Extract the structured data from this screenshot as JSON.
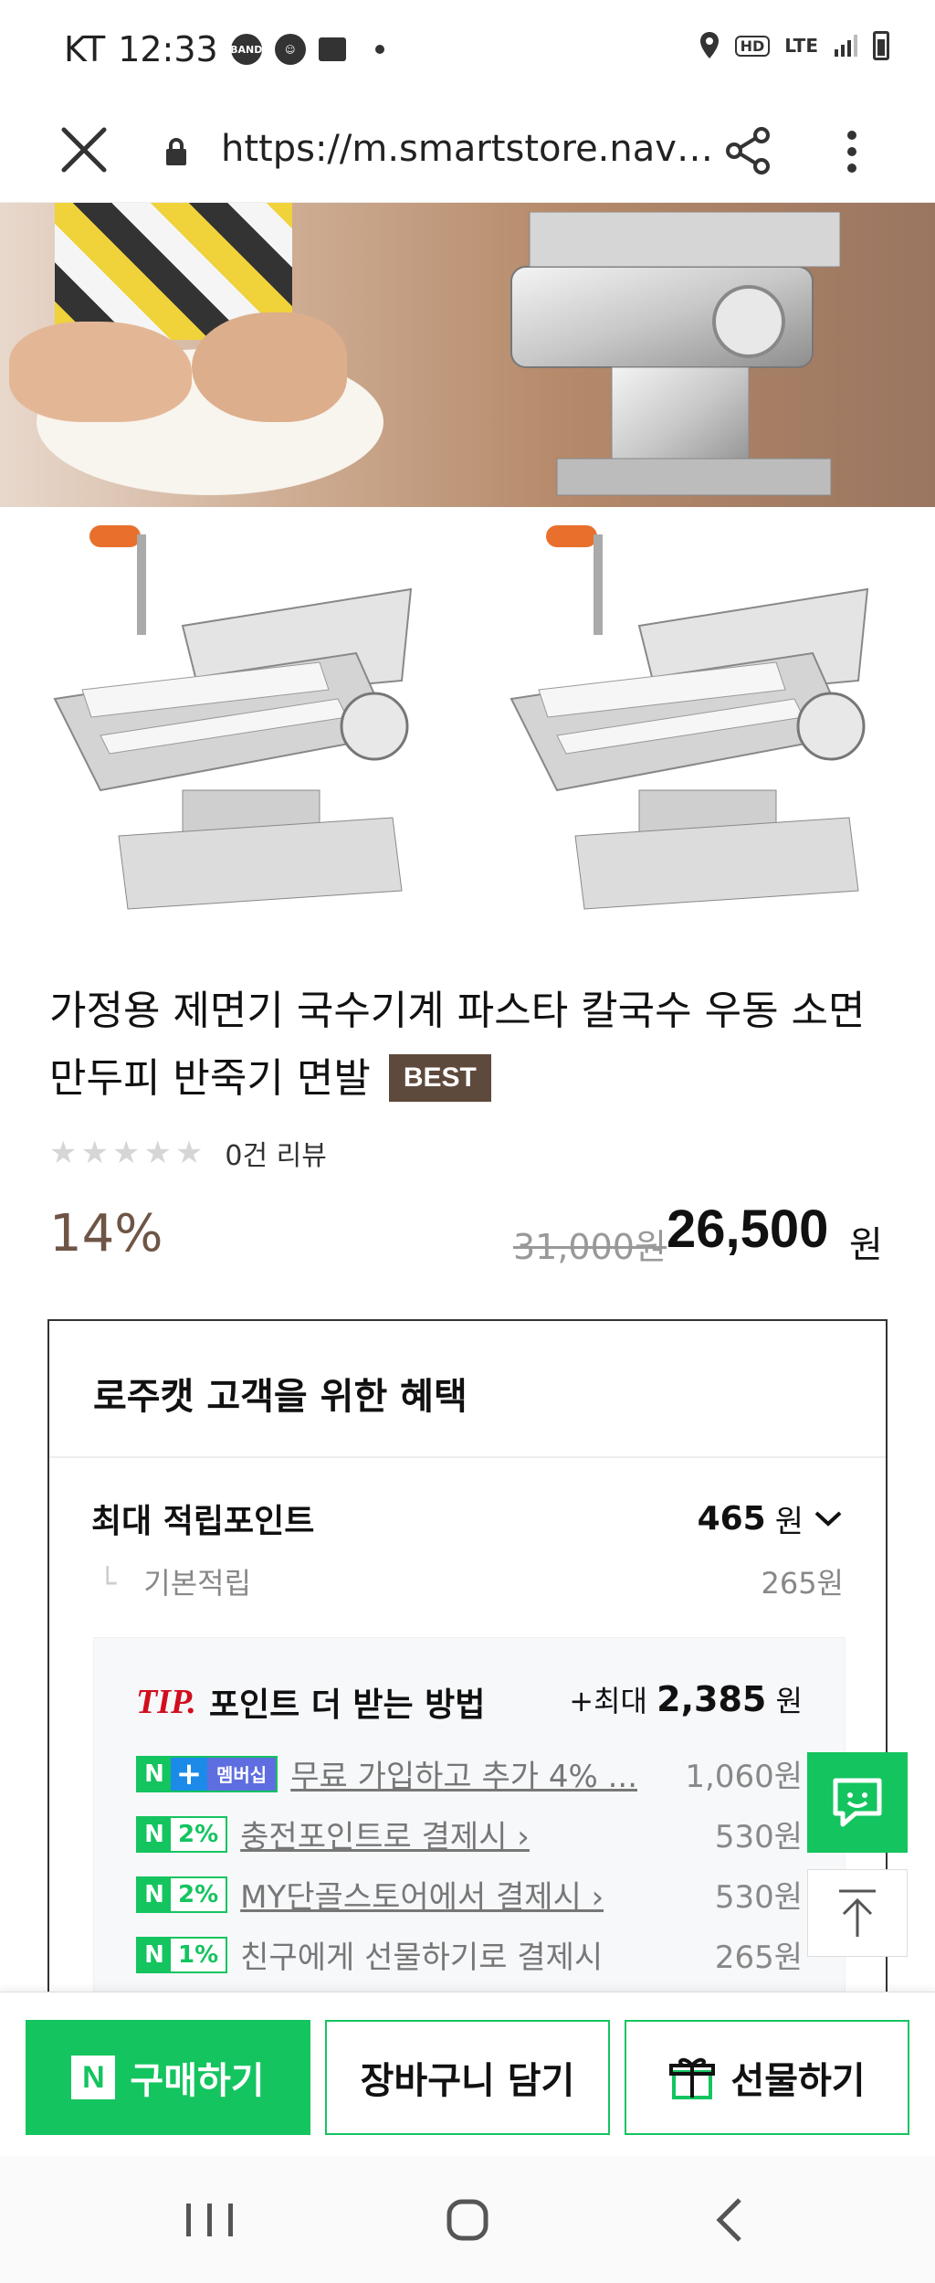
{
  "status_bar": {
    "carrier": "KT",
    "time": "12:33",
    "notif_band": "BAND",
    "network": "LTE"
  },
  "browser": {
    "url": "https://m.smartstore.naver..."
  },
  "product": {
    "title": "가정용 제면기 국수기계 파스타 칼국수 우동 소면 만두피 반죽기 면발",
    "badge": "BEST",
    "stars": "★★★★★",
    "review_text": "0건 리뷰",
    "discount": "14%",
    "original_price": "31,000원",
    "price": "26,500",
    "price_unit": "원"
  },
  "benefits": {
    "header": "로주캣 고객을 위한 혜택",
    "max_points_label": "최대 적립포인트",
    "max_points_value": "465",
    "max_points_unit": "원",
    "basic_label": "기본적립",
    "basic_value": "265원",
    "tip": {
      "tip_word": "TIP.",
      "title": "포인트 더 받는 방법",
      "max_prefix": "+최대",
      "max_value": "2,385",
      "max_unit": "원",
      "rows": [
        {
          "badge_n": "N",
          "badge_plus": "+",
          "badge": "멤버십",
          "text": "무료 가입하고 추가 4% ...",
          "value": "1,060원"
        },
        {
          "badge_n": "N",
          "badge": "2%",
          "text": "충전포인트로 결제시 ›",
          "value": "530원"
        },
        {
          "badge_n": "N",
          "badge": "2%",
          "text": "MY단골스토어에서 결제시 ›",
          "value": "530원"
        },
        {
          "badge_n": "N",
          "badge": "1%",
          "text": "친구에게 선물하기로 결제시",
          "value": "265원"
        }
      ]
    }
  },
  "bottom_actions": {
    "buy_logo": "N",
    "buy": "구매하기",
    "cart": "장바구니 담기",
    "gift": "선물하기"
  },
  "colors": {
    "naver_green": "#14c45f",
    "brown": "#6e5545",
    "badge_brown": "#5e4a3c",
    "tip_red": "#d10f1e"
  },
  "icons": [
    "close-icon",
    "lock-icon",
    "share-icon",
    "more-icon",
    "chat-icon",
    "scroll-top-icon",
    "gift-icon",
    "recent-apps-icon",
    "home-icon",
    "back-icon"
  ]
}
